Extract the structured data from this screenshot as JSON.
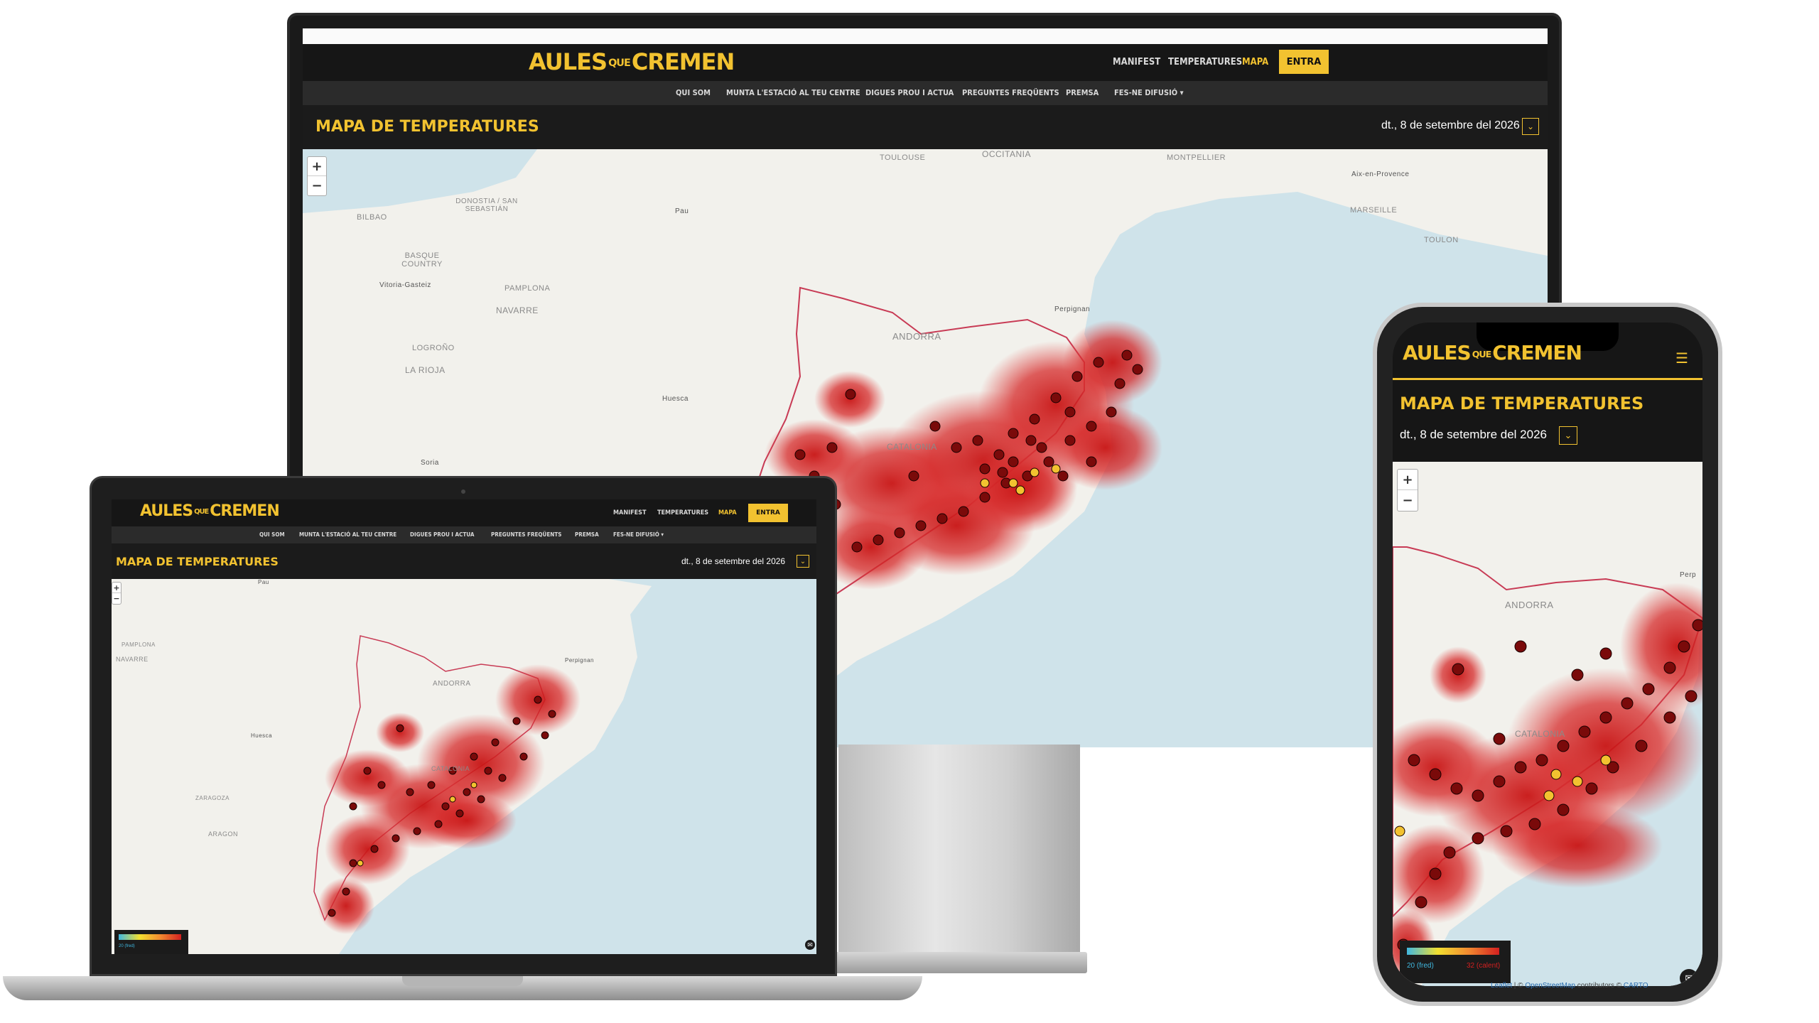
{
  "brand": {
    "logo_main": "AULES",
    "logo_small": "QUE",
    "logo_end": "CREMEN"
  },
  "nav": {
    "top": [
      {
        "label": "MANIFEST"
      },
      {
        "label": "TEMPERATURES"
      },
      {
        "label": "MAPA",
        "active": true
      }
    ],
    "cta": "ENTRA",
    "secondary": [
      {
        "label": "QUI SOM"
      },
      {
        "label": "MUNTA L'ESTACIÓ AL TEU CENTRE"
      },
      {
        "label": "DIGUES PROU I ACTUA"
      },
      {
        "label": "PREGUNTES FREQÜENTS"
      },
      {
        "label": "PREMSA"
      },
      {
        "label": "FES-NE DIFUSIÓ"
      }
    ]
  },
  "page": {
    "title": "MAPA DE TEMPERATURES",
    "date": "dt., 8 de setembre del 2026"
  },
  "map": {
    "zoom_in": "+",
    "zoom_out": "−",
    "labels_desktop": {
      "toulouse": "TOULOUSE",
      "occitania": "OCCITANIA",
      "montpellier": "MONTPELLIER",
      "aix": "Aix-en-Provence",
      "marseille": "MARSEILLE",
      "toulon": "TOULON",
      "bilbao": "BILBAO",
      "donostia": "DONOSTIA / SAN SEBASTIÁN",
      "pau": "Pau",
      "basque": "BASQUE COUNTRY",
      "vitoria": "Vitoria-Gasteiz",
      "pamplona": "PAMPLONA",
      "navarre": "NAVARRE",
      "perpignan": "Perpignan",
      "andorra": "ANDORRA",
      "logrono": "LOGROÑO",
      "larioja": "LA RIOJA",
      "huesca": "Huesca",
      "soria": "Soria",
      "catalonia": "CATALONIA"
    },
    "labels_laptop": {
      "pamplona": "PAMPLONA",
      "navarre": "NAVARRE",
      "perpignan": "Perpignan",
      "andorra": "ANDORRA",
      "huesca": "Huesca",
      "zaragoza": "ZARAGOZA",
      "aragon": "ARAGON",
      "catalonia": "CATALONIA",
      "pau": "Pau"
    },
    "labels_phone": {
      "andorra": "ANDORRA",
      "catalonia": "CATALONIA",
      "perp": "Perp"
    },
    "legend": {
      "min": "20 (fred)",
      "max": "32 (calent)"
    },
    "attribution": {
      "leaflet": "Leaflet",
      "osm": "OpenStreetMap",
      "contributors": "contributors ©",
      "carto": "CARTO"
    }
  },
  "colors": {
    "accent": "#f2c230",
    "header_bg": "#1b1b1b",
    "hot": "#d32020",
    "sea": "#cfe3ea",
    "land": "#f2f1ec"
  },
  "icons": {
    "pin": "flame-pin-icon",
    "menu": "hamburger-menu-icon",
    "chevron": "chevron-down-icon",
    "mail": "mail-icon"
  }
}
